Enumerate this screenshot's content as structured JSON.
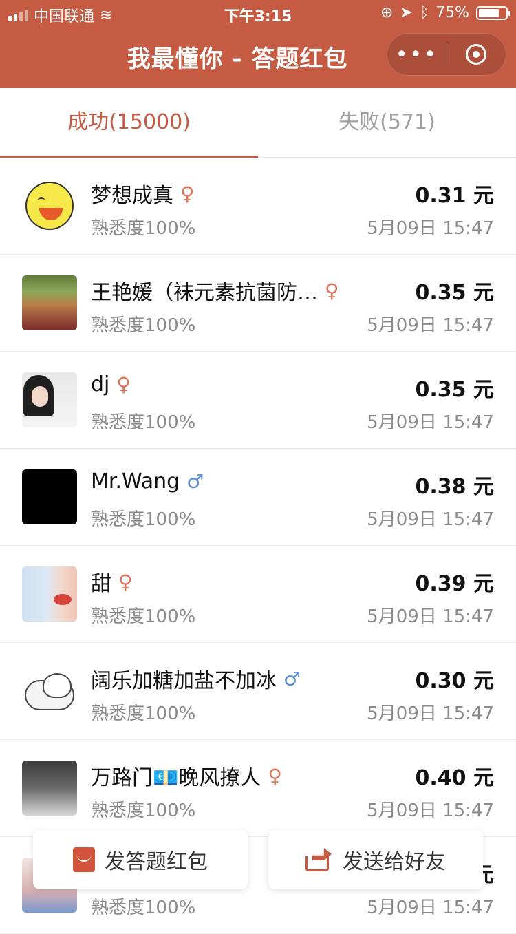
{
  "status": {
    "carrier": "中国联通",
    "time": "下午3:15",
    "battery": "75%"
  },
  "header": {
    "title": "我最懂你 - 答题红包",
    "more_icon": "•••"
  },
  "tabs": [
    {
      "label": "成功(15000)",
      "active": true
    },
    {
      "label": "失败(571)",
      "active": false
    }
  ],
  "rows": [
    {
      "name": "梦想成真",
      "gender": "♀",
      "familiarity": "熟悉度100%",
      "amount": "0.31 元",
      "date": "5月09日 15:47"
    },
    {
      "name": "王艳媛（袜元素抗菌防…",
      "gender": "♀",
      "familiarity": "熟悉度100%",
      "amount": "0.35 元",
      "date": "5月09日 15:47"
    },
    {
      "name": "dj",
      "gender": "♀",
      "familiarity": "熟悉度100%",
      "amount": "0.35 元",
      "date": "5月09日 15:47"
    },
    {
      "name": "Mr.Wang",
      "gender": "♂",
      "familiarity": "熟悉度100%",
      "amount": "0.38 元",
      "date": "5月09日 15:47"
    },
    {
      "name": "甜",
      "gender": "♀",
      "familiarity": "熟悉度100%",
      "amount": "0.39 元",
      "date": "5月09日 15:47"
    },
    {
      "name": "阔乐加糖加盐不加冰",
      "gender": "♂",
      "familiarity": "熟悉度100%",
      "amount": "0.30 元",
      "date": "5月09日 15:47"
    },
    {
      "name": "万路门💶晚风撩人",
      "gender": "♀",
      "familiarity": "熟悉度100%",
      "amount": "0.40 元",
      "date": "5月09日 15:47"
    },
    {
      "name": "",
      "gender": "",
      "familiarity": "熟悉度100%",
      "amount": "元",
      "date": "5月09日 15:47"
    }
  ],
  "buttons": {
    "send_quiz": "发答题红包",
    "send_friend": "发送给好友"
  },
  "colors": {
    "brand": "#c45b42",
    "female": "#e0735a",
    "male": "#5a8fd8"
  }
}
